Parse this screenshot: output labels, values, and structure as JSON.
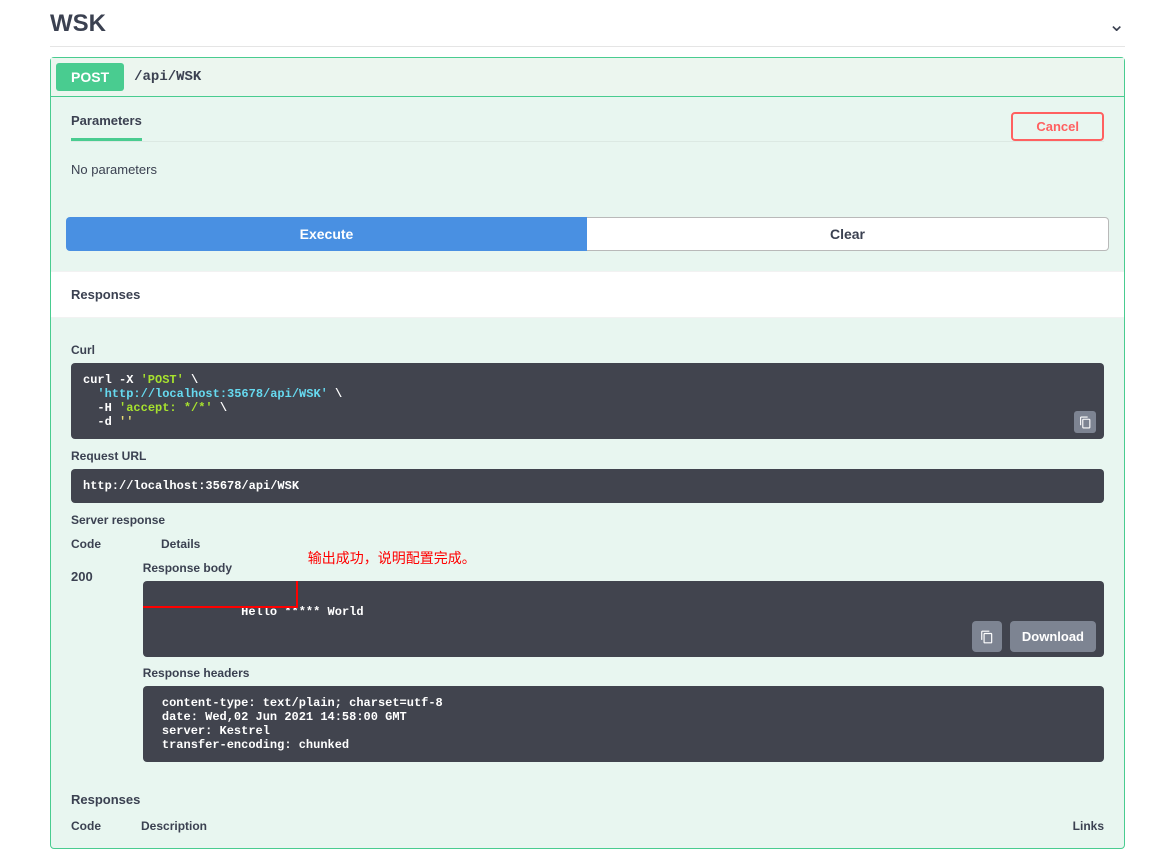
{
  "header": {
    "title": "WSK"
  },
  "summary": {
    "method": "POST",
    "path": "/api/WSK"
  },
  "tabs": {
    "parameters": "Parameters",
    "cancel": "Cancel"
  },
  "params": {
    "none": "No parameters"
  },
  "buttons": {
    "execute": "Execute",
    "clear": "Clear",
    "download": "Download"
  },
  "sections": {
    "responses": "Responses",
    "curl": "Curl",
    "request_url": "Request URL",
    "server_response": "Server response",
    "response_body": "Response body",
    "response_headers": "Response headers"
  },
  "curl": {
    "line1a": "curl -X ",
    "line1b": "'POST'",
    "line1c": " \\",
    "line2a": "  ",
    "line2b": "'http://localhost:35678/api/WSK'",
    "line2c": " \\",
    "line3a": "  -H ",
    "line3b": "'accept: */*'",
    "line3c": " \\",
    "line4a": "  -d ",
    "line4b": "''"
  },
  "request_url": "http://localhost:35678/api/WSK",
  "server_table": {
    "code_h": "Code",
    "details_h": "Details"
  },
  "status_code": "200",
  "response_body": "Hello ***** World",
  "annotation": "输出成功，说明配置完成。",
  "response_headers": " content-type: text/plain; charset=utf-8 \n date: Wed,02 Jun 2021 14:58:00 GMT \n server: Kestrel \n transfer-encoding: chunked ",
  "lower": {
    "responses": "Responses",
    "code": "Code",
    "description": "Description",
    "links": "Links"
  }
}
